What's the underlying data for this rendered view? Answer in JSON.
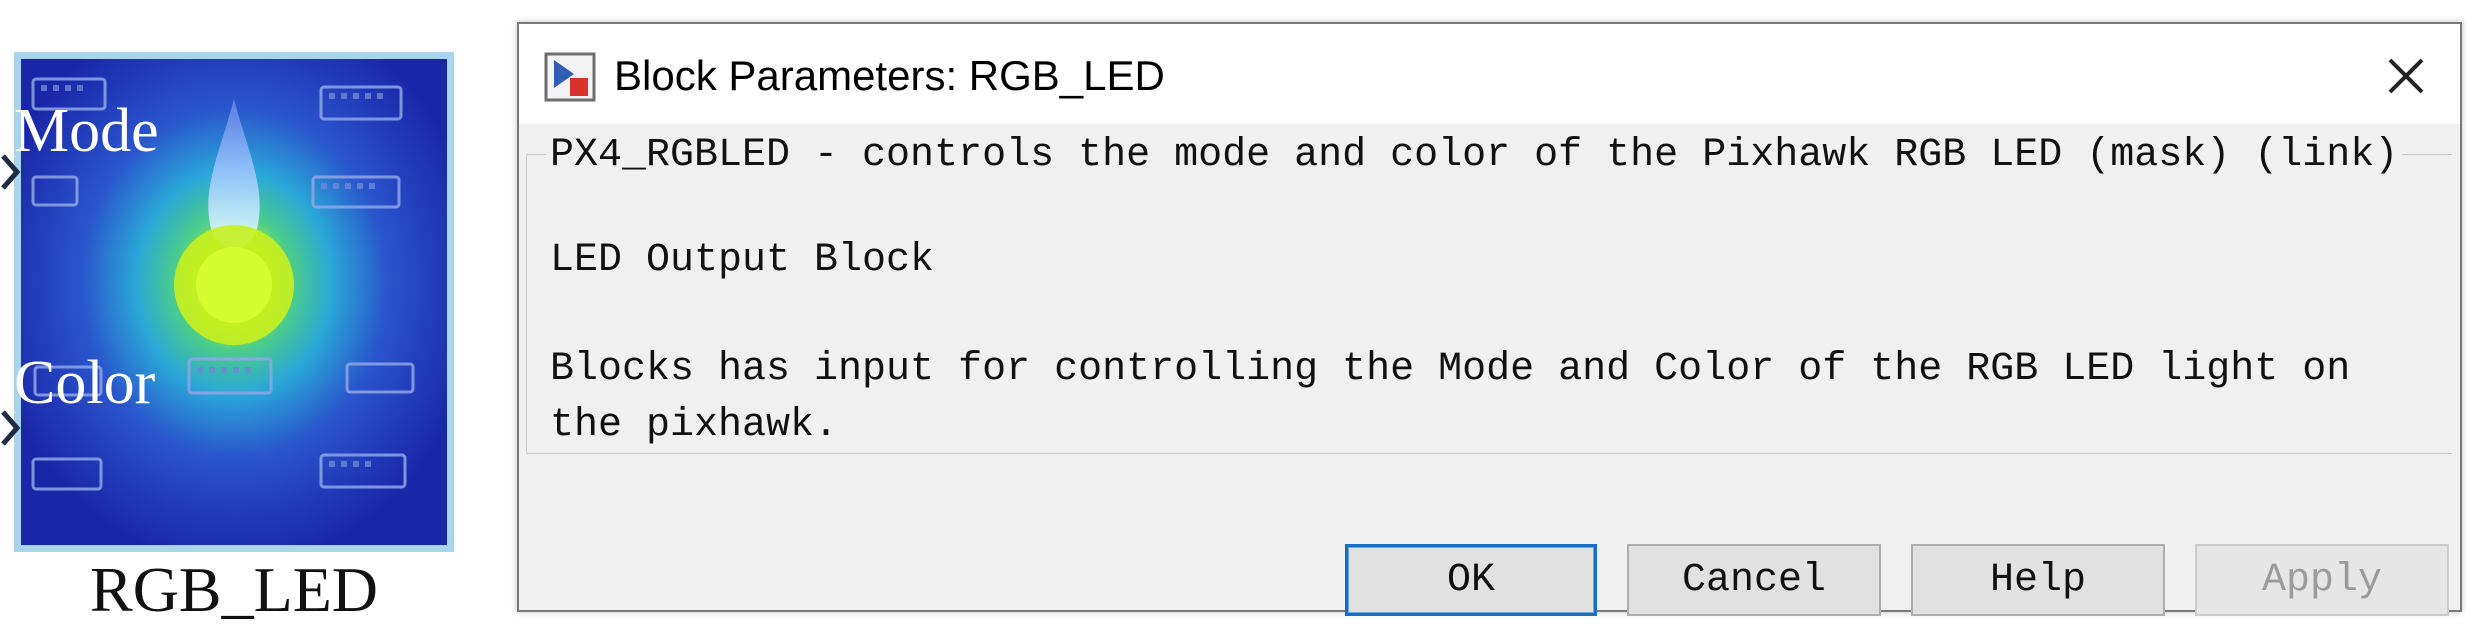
{
  "block": {
    "ports": {
      "mode": "Mode",
      "color": "Color"
    },
    "name": "RGB_LED"
  },
  "dialog": {
    "title": "Block Parameters: RGB_LED",
    "icon": "simulink-block-icon",
    "group_title": "PX4_RGBLED - controls the mode and color of the Pixhawk RGB LED (mask) (link)",
    "block_type": "LED Output Block",
    "description": "Blocks has input for controlling the Mode and Color of the RGB LED light on\nthe pixhawk.",
    "buttons": {
      "ok": "OK",
      "cancel": "Cancel",
      "help": "Help",
      "apply": "Apply"
    }
  },
  "colors": {
    "focus_border": "#1a6fc4",
    "block_border": "#a9d4ee",
    "block_background": "#1c2fb4",
    "led_glow": "#b8f020",
    "disabled_text": "#9b9b9b"
  }
}
